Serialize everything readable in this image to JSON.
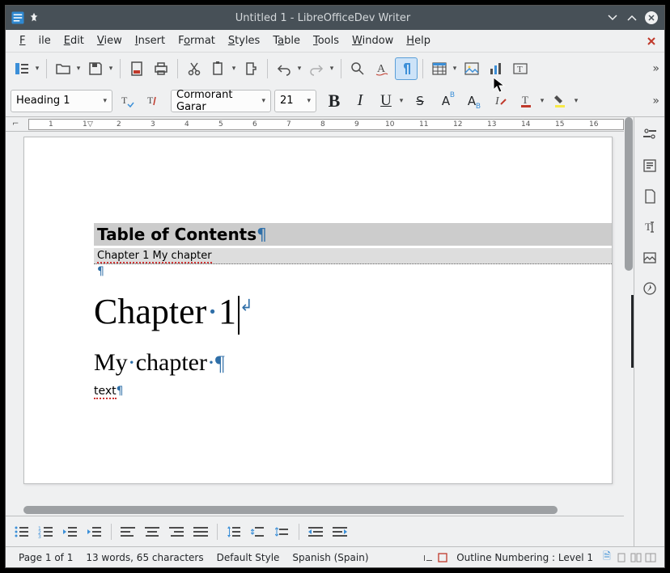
{
  "window": {
    "title": "Untitled 1 - LibreOfficeDev Writer"
  },
  "menu": {
    "file": "File",
    "edit": "Edit",
    "view": "View",
    "insert": "Insert",
    "format": "Format",
    "styles": "Styles",
    "table": "Table",
    "tools": "Tools",
    "window": "Window",
    "help": "Help"
  },
  "fmt": {
    "style": "Heading 1",
    "font": "Cormorant Garar",
    "size": "21"
  },
  "doc": {
    "toc_title": "Table of Contents",
    "toc_entry": "Chapter 1  My chapter",
    "h1": "Chapter·1",
    "h2": "My·chapter·",
    "body": "text"
  },
  "ruler": {
    "marks": [
      "1",
      "1",
      "2",
      "3",
      "4",
      "5",
      "6",
      "7",
      "8",
      "9",
      "10",
      "11",
      "12",
      "13",
      "14",
      "15",
      "16"
    ]
  },
  "statusbar": {
    "page": "Page 1 of 1",
    "words": "13 words, 65 characters",
    "style": "Default Style",
    "lang": "Spanish (Spain)",
    "outline": "Outline Numbering : Level 1"
  }
}
